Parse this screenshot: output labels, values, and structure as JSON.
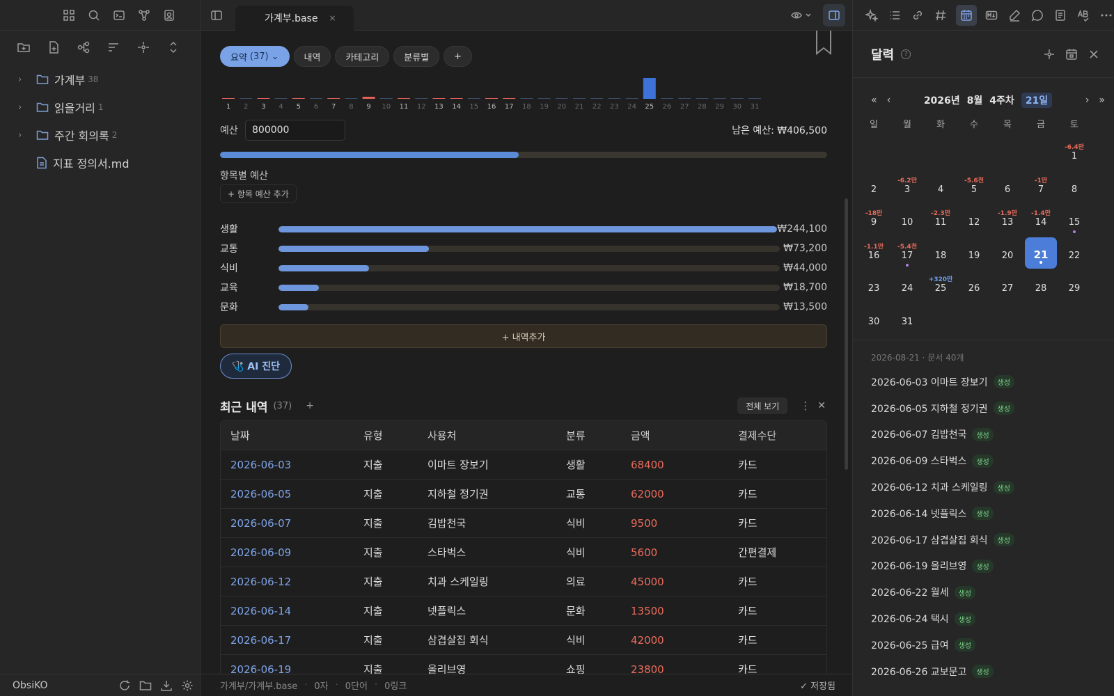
{
  "left": {
    "brand": "ObsiKO",
    "tree": [
      {
        "type": "folder",
        "label": "가계부",
        "count": "38"
      },
      {
        "type": "folder",
        "label": "읽을거리",
        "count": "1"
      },
      {
        "type": "folder",
        "label": "주간 회의록",
        "count": "2"
      },
      {
        "type": "file",
        "label": "지표 정의서.md",
        "count": ""
      }
    ]
  },
  "tab": {
    "title": "가계부.base",
    "close": "×"
  },
  "views": {
    "items": [
      {
        "label": "요약",
        "count": "(37)",
        "arrow": "⌄",
        "active": true
      },
      {
        "label": "내역",
        "active": false
      },
      {
        "label": "카테고리",
        "active": false
      },
      {
        "label": "분류별",
        "active": false
      },
      {
        "label": "+",
        "active": false
      }
    ]
  },
  "daybars": {
    "days": [
      "1",
      "2",
      "3",
      "4",
      "5",
      "6",
      "7",
      "8",
      "9",
      "10",
      "11",
      "12",
      "13",
      "14",
      "15",
      "16",
      "17",
      "18",
      "19",
      "20",
      "21",
      "22",
      "23",
      "24",
      "25",
      "26",
      "27",
      "28",
      "29",
      "30",
      "31"
    ],
    "heights": [
      1,
      0,
      1,
      0,
      1,
      0,
      1,
      0,
      3,
      0,
      1,
      0,
      1,
      1,
      0,
      1,
      1,
      0,
      0,
      0,
      0,
      0,
      0,
      0,
      30,
      0,
      0,
      0,
      0,
      0,
      0
    ],
    "kind": [
      "e",
      "n",
      "e",
      "n",
      "e",
      "n",
      "e",
      "n",
      "e",
      "n",
      "e",
      "n",
      "e",
      "e",
      "n",
      "e",
      "e",
      "n",
      "n",
      "n",
      "n",
      "n",
      "n",
      "n",
      "i",
      "n",
      "n",
      "n",
      "n",
      "n",
      "n"
    ],
    "colors": {
      "expense": "#e0605a",
      "income": "#3d73d8",
      "none": "#3b4a66"
    }
  },
  "budget": {
    "label": "예산",
    "value": "800000",
    "remaining": "남은 예산: ₩406,500",
    "fill_pct": 49.2
  },
  "category_budget": {
    "title": "항목별 예산",
    "add": "+ 항목 예산 추가"
  },
  "categories": [
    {
      "name": "생활",
      "amount": "₩244,100",
      "fill_pct": 100
    },
    {
      "name": "교통",
      "amount": "₩73,200",
      "fill_pct": 30
    },
    {
      "name": "식비",
      "amount": "₩44,000",
      "fill_pct": 18
    },
    {
      "name": "교육",
      "amount": "₩18,700",
      "fill_pct": 8
    },
    {
      "name": "문화",
      "amount": "₩13,500",
      "fill_pct": 6
    }
  ],
  "add_entry": "+ 내역추가",
  "ai_button": "🩺 AI 진단",
  "recent": {
    "title": "최근 내역",
    "count": "(37)",
    "plus": "+",
    "view_all": "전체 보기",
    "more": "⋮",
    "close": "✕",
    "columns": [
      "날짜",
      "유형",
      "사용처",
      "분류",
      "금액",
      "결제수단"
    ],
    "rows": [
      [
        "2026-06-03",
        "지출",
        "이마트 장보기",
        "생활",
        "68400",
        "카드"
      ],
      [
        "2026-06-05",
        "지출",
        "지하철 정기권",
        "교통",
        "62000",
        "카드"
      ],
      [
        "2026-06-07",
        "지출",
        "김밥천국",
        "식비",
        "9500",
        "카드"
      ],
      [
        "2026-06-09",
        "지출",
        "스타벅스",
        "식비",
        "5600",
        "간편결제"
      ],
      [
        "2026-06-12",
        "지출",
        "치과 스케일링",
        "의료",
        "45000",
        "카드"
      ],
      [
        "2026-06-14",
        "지출",
        "넷플릭스",
        "문화",
        "13500",
        "카드"
      ],
      [
        "2026-06-17",
        "지출",
        "삼겹살집 회식",
        "식비",
        "42000",
        "카드"
      ],
      [
        "2026-06-19",
        "지출",
        "올리브영",
        "쇼핑",
        "23800",
        "카드"
      ]
    ]
  },
  "status": {
    "path": "가계부/가계부.base",
    "chars": "0자",
    "words": "0단어",
    "links": "0링크",
    "saved": "✓ 저장됨"
  },
  "calendar": {
    "title": "달력",
    "help": "?",
    "nav": {
      "prev2": "«",
      "prev": "‹",
      "year": "2026년",
      "month": "8월",
      "week": "4주차",
      "day": "21일",
      "next": "›",
      "next2": "»"
    },
    "weekdays": [
      "일",
      "월",
      "화",
      "수",
      "목",
      "금",
      "토"
    ],
    "weeks": [
      [
        {
          "d": ""
        },
        {
          "d": ""
        },
        {
          "d": ""
        },
        {
          "d": ""
        },
        {
          "d": ""
        },
        {
          "d": ""
        },
        {
          "d": "1",
          "amt": "-6.4만"
        }
      ],
      [
        {
          "d": "2"
        },
        {
          "d": "3",
          "amt": "-6.2만"
        },
        {
          "d": "4"
        },
        {
          "d": "5",
          "amt": "-5.6천"
        },
        {
          "d": "6"
        },
        {
          "d": "7",
          "amt": "-1만"
        },
        {
          "d": "8"
        }
      ],
      [
        {
          "d": "9",
          "amt": "-18만"
        },
        {
          "d": "10"
        },
        {
          "d": "11",
          "amt": "-2.3만"
        },
        {
          "d": "12"
        },
        {
          "d": "13",
          "amt": "-1.9만"
        },
        {
          "d": "14",
          "amt": "-1.4만"
        },
        {
          "d": "15",
          "mark": true
        }
      ],
      [
        {
          "d": "16",
          "amt": "-1.1만"
        },
        {
          "d": "17",
          "amt": "-5.4천",
          "mark": true
        },
        {
          "d": "18"
        },
        {
          "d": "19"
        },
        {
          "d": "20"
        },
        {
          "d": "21",
          "today": true,
          "mark": true
        },
        {
          "d": "22"
        }
      ],
      [
        {
          "d": "23"
        },
        {
          "d": "24"
        },
        {
          "d": "25",
          "amt": "+320만",
          "income": true
        },
        {
          "d": "26"
        },
        {
          "d": "27"
        },
        {
          "d": "28"
        },
        {
          "d": "29"
        }
      ],
      [
        {
          "d": "30"
        },
        {
          "d": "31"
        },
        {
          "d": ""
        },
        {
          "d": ""
        },
        {
          "d": ""
        },
        {
          "d": ""
        },
        {
          "d": ""
        }
      ]
    ],
    "doc_meta": "2026-08-21 · 문서 40개",
    "docs": [
      {
        "title": "2026-06-03 이마트 장보기",
        "badge": "생성"
      },
      {
        "title": "2026-06-05 지하철 정기권",
        "badge": "생성"
      },
      {
        "title": "2026-06-07 김밥천국",
        "badge": "생성"
      },
      {
        "title": "2026-06-09 스타벅스",
        "badge": "생성"
      },
      {
        "title": "2026-06-12 치과 스케일링",
        "badge": "생성"
      },
      {
        "title": "2026-06-14 넷플릭스",
        "badge": "생성"
      },
      {
        "title": "2026-06-17 삼겹살집 회식",
        "badge": "생성"
      },
      {
        "title": "2026-06-19 올리브영",
        "badge": "생성"
      },
      {
        "title": "2026-06-22 월세",
        "badge": "생성"
      },
      {
        "title": "2026-06-24 택시",
        "badge": "생성"
      },
      {
        "title": "2026-06-25 급여",
        "badge": "생성"
      },
      {
        "title": "2026-06-26 교보문고",
        "badge": "생성"
      }
    ]
  }
}
